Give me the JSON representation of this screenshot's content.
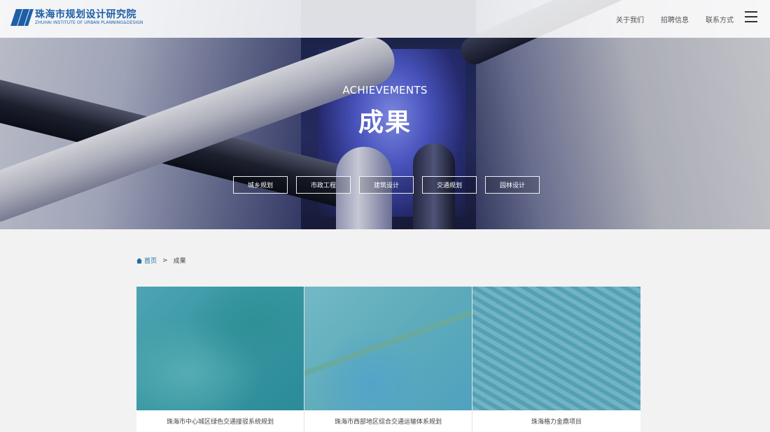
{
  "header": {
    "logo_cn": "珠海市规划设计研究院",
    "logo_en": "ZHUHAI INSTITUTE OF URBAN PLANNING&DESIGN",
    "nav": [
      "关于我们",
      "招聘信息",
      "联系方式"
    ],
    "menu_icon": "hamburger-icon"
  },
  "hero": {
    "title_en": "ACHIEVEMENTS",
    "title_cn": "成果",
    "categories": [
      "城乡规划",
      "市政工程",
      "建筑设计",
      "交通规划",
      "园林设计"
    ]
  },
  "breadcrumb": {
    "home_icon": "home-icon",
    "home": "首页",
    "separator": ">",
    "current": "成果"
  },
  "projects": [
    {
      "title": "珠海市中心城区绿色交通接驳系统规划"
    },
    {
      "title": "珠海市西部地区综合交通运输体系规划"
    },
    {
      "title": "珠海格力金鼎项目"
    }
  ],
  "colors": {
    "brand": "#1d5fa6",
    "overlay": "#2896be"
  }
}
